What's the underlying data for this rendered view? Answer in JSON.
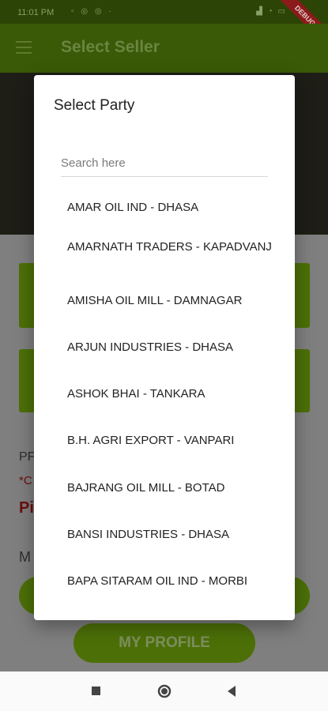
{
  "status_bar": {
    "time": "11:01 PM",
    "debug_label": "DEBUG"
  },
  "app_bar": {
    "title": "Select Seller"
  },
  "background": {
    "fragments": [
      "PF",
      "*C",
      "Pi",
      "M"
    ],
    "profile_button_label": "MY PROFILE"
  },
  "dialog": {
    "title": "Select Party",
    "search_placeholder": "Search here",
    "parties": [
      "AMAR OIL IND - DHASA",
      "AMARNATH TRADERS - KAPADVANJ",
      "AMISHA OIL MILL - DAMNAGAR",
      "ARJUN  INDUSTRIES - DHASA",
      "ASHOK BHAI - TANKARA",
      "B.H. AGRI EXPORT - VANPARI",
      "BAJRANG OIL MILL - BOTAD",
      "BANSI INDUSTRIES - DHASA",
      "BAPA SITARAM OIL IND - MORBI"
    ]
  },
  "nav_bar": {
    "icons": [
      "recents-square-icon",
      "home-circle-icon",
      "back-triangle-icon"
    ]
  }
}
